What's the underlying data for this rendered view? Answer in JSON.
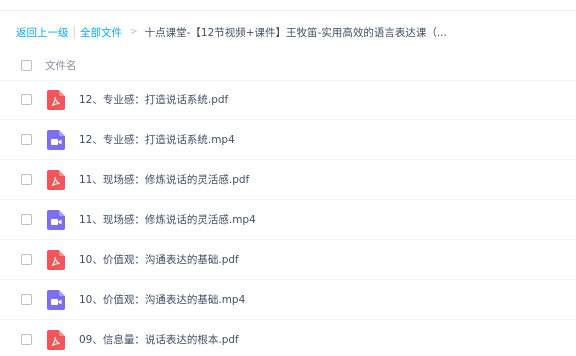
{
  "breadcrumb": {
    "back_label": "返回上一级",
    "separator": "|",
    "all_files_label": "全部文件",
    "arrow": ">",
    "current_folder": "十点课堂-【12节视频+课件】王牧笛-实用高效的语言表达课（..."
  },
  "file_list": {
    "header_label": "文件名",
    "files": [
      {
        "name": "12、专业感：打造说话系统.pdf",
        "type": "pdf"
      },
      {
        "name": "12、专业感：打造说话系统.mp4",
        "type": "video"
      },
      {
        "name": "11、现场感：修炼说话的灵活感.pdf",
        "type": "pdf"
      },
      {
        "name": "11、现场感：修炼说话的灵活感.mp4",
        "type": "video"
      },
      {
        "name": "10、价值观：沟通表达的基础.pdf",
        "type": "pdf"
      },
      {
        "name": "10、价值观：沟通表达的基础.mp4",
        "type": "video"
      },
      {
        "name": "09、信息量：说话表达的根本.pdf",
        "type": "pdf"
      }
    ]
  },
  "colors": {
    "link": "#09aaff",
    "pdf_icon": "#f2565a",
    "video_icon": "#7b6ef0",
    "text": "#424e67"
  }
}
